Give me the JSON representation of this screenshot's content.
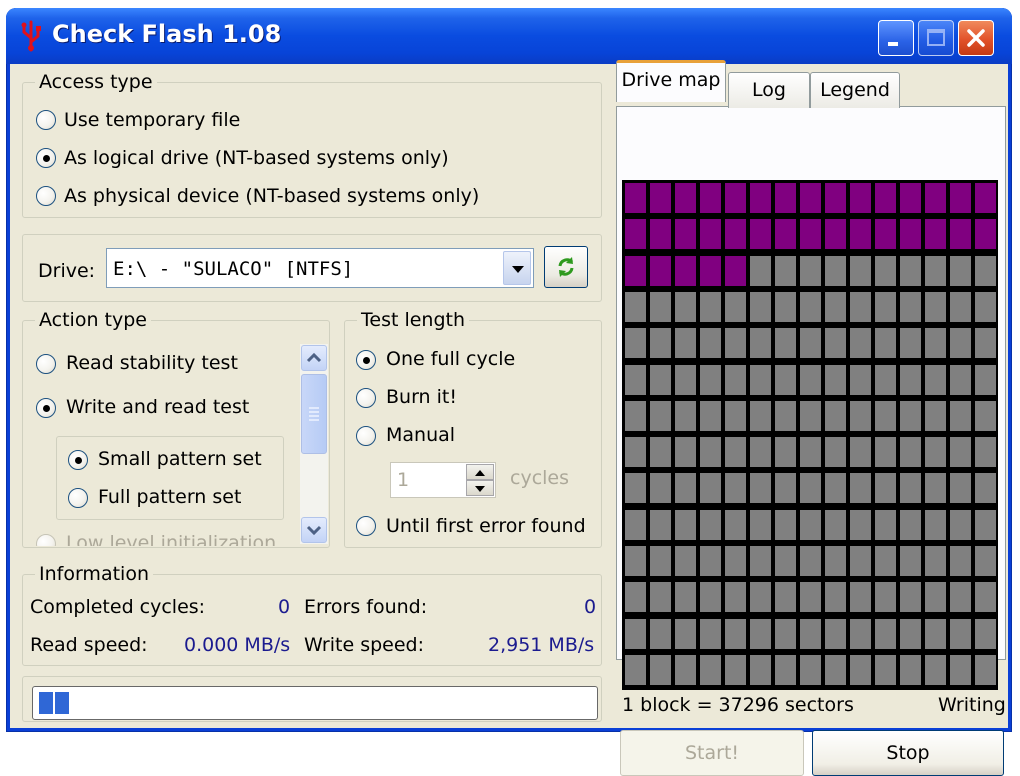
{
  "window": {
    "title": "Check Flash 1.08",
    "buttons": {
      "minimize": "minimize-icon",
      "maximize": "maximize-icon",
      "close": "close-icon"
    }
  },
  "access_type": {
    "title": "Access type",
    "options": [
      {
        "label": "Use temporary file",
        "checked": false
      },
      {
        "label": "As logical drive (NT-based systems only)",
        "checked": true
      },
      {
        "label": "As physical device (NT-based systems only)",
        "checked": false
      }
    ]
  },
  "drive": {
    "label": "Drive:",
    "value": "E:\\  -  \"SULACO\" [NTFS]",
    "refresh_icon": "refresh-icon"
  },
  "action_type": {
    "title": "Action type",
    "options": [
      {
        "label": "Read stability test",
        "checked": false
      },
      {
        "label": "Write and read test",
        "checked": true
      },
      {
        "label": "Low level initialization",
        "checked": false
      }
    ],
    "pattern_options": [
      {
        "label": "Small pattern set",
        "checked": true
      },
      {
        "label": "Full pattern set",
        "checked": false
      }
    ]
  },
  "test_length": {
    "title": "Test length",
    "options": [
      {
        "label": "One full cycle",
        "checked": true
      },
      {
        "label": "Burn it!",
        "checked": false
      },
      {
        "label": "Manual",
        "checked": false
      },
      {
        "label": "Until first error found",
        "checked": false
      }
    ],
    "cycles_value": "1",
    "cycles_label": "cycles"
  },
  "information": {
    "title": "Information",
    "completed_cycles_label": "Completed cycles:",
    "completed_cycles_value": "0",
    "errors_found_label": "Errors found:",
    "errors_found_value": "0",
    "read_speed_label": "Read speed:",
    "read_speed_value": "0.000 MB/s",
    "write_speed_label": "Write speed:",
    "write_speed_value": "2,951 MB/s"
  },
  "tabs": [
    {
      "label": "Drive map",
      "active": true
    },
    {
      "label": "Log",
      "active": false
    },
    {
      "label": "Legend",
      "active": false
    }
  ],
  "drive_map": {
    "columns": 15,
    "rows": 14,
    "written_blocks": 35,
    "written_color": "#800080",
    "empty_color": "#808080"
  },
  "status": {
    "block_info": "1 block = 37296 sectors",
    "state": "Writing"
  },
  "progress": {
    "chunks": 2
  },
  "buttons": {
    "start": "Start!",
    "stop": "Stop"
  },
  "colors": {
    "title_blue": "#0a4ce0",
    "face": "#ece9d8",
    "accent_blue": "#1b1b8f"
  }
}
